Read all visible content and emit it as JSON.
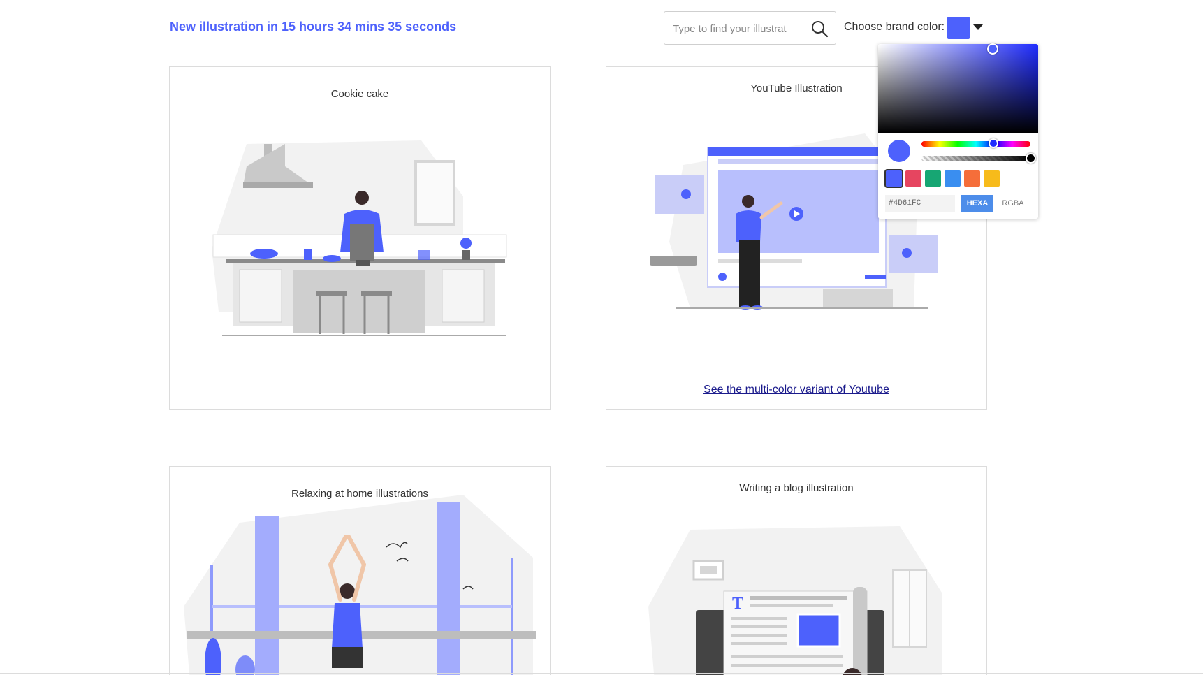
{
  "header": {
    "countdown": "New illustration in 15 hours 34 mins 35 seconds",
    "search_placeholder": "Type to find your illustrat",
    "brand_label": "Choose brand color:",
    "brand_color": "#4D61FC"
  },
  "cards": [
    {
      "title": "Cookie cake"
    },
    {
      "title": "YouTube Illustration",
      "link": "See the multi-color variant of Youtube"
    },
    {
      "title": "Relaxing at home illustrations"
    },
    {
      "title": "Writing a blog illustration"
    }
  ],
  "color_picker": {
    "hex_value": "#4D61FC",
    "presets": [
      "#4D61FC",
      "#E64560",
      "#17A673",
      "#3A8EF0",
      "#F56E3A",
      "#F7BB1B"
    ],
    "mode_hexa": "HEXA",
    "mode_rgba": "RGBA"
  }
}
